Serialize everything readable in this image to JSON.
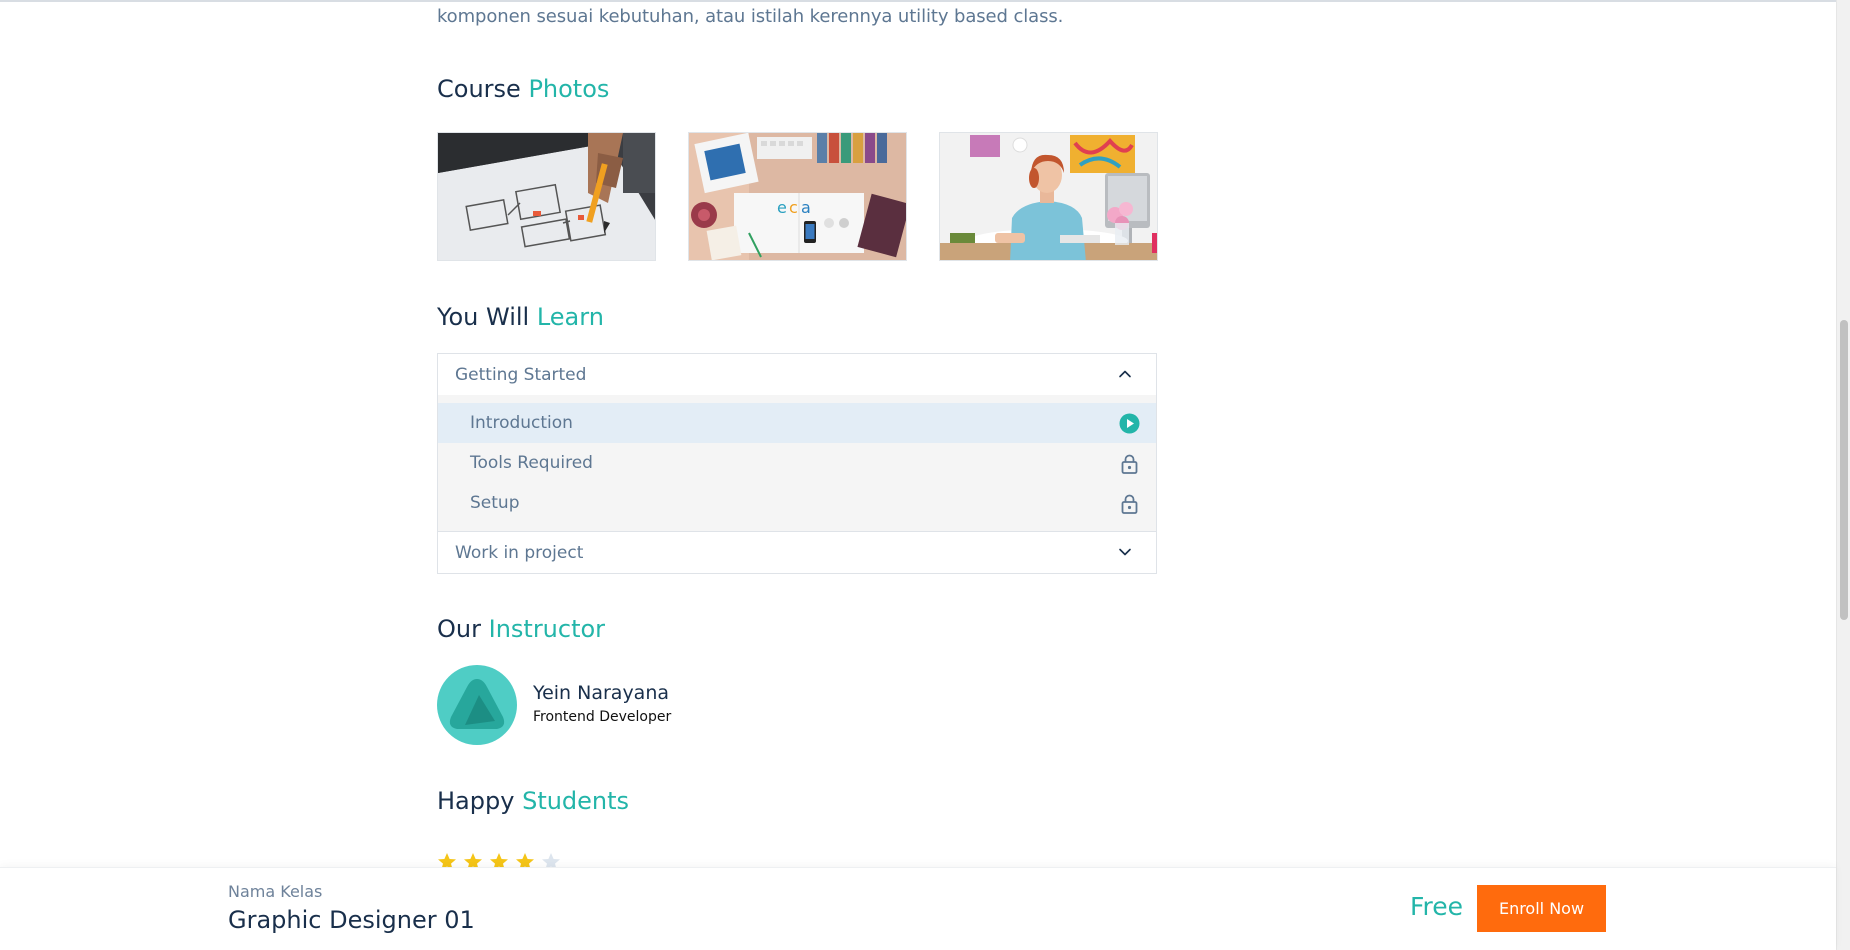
{
  "intro": {
    "text": "komponen sesuai kebutuhan, atau istilah kerennya utility based class."
  },
  "sections": {
    "photos": {
      "part1": "Course",
      "part2": "Photos"
    },
    "learn": {
      "part1": "You Will",
      "part2": "Learn"
    },
    "instructor": {
      "part1": "Our",
      "part2": "Instructor"
    },
    "students": {
      "part1": "Happy",
      "part2": "Students"
    }
  },
  "photos": [
    {
      "name": "wireframe-sketch-photo"
    },
    {
      "name": "desk-flatlay-photo"
    },
    {
      "name": "woman-at-desk-photo"
    }
  ],
  "accordion": {
    "groups": [
      {
        "title": "Getting Started",
        "expanded": true,
        "icon": "chevron-up-icon",
        "lessons": [
          {
            "title": "Introduction",
            "icon": "play-icon",
            "active": true
          },
          {
            "title": "Tools Required",
            "icon": "lock-icon",
            "active": false
          },
          {
            "title": "Setup",
            "icon": "lock-icon",
            "active": false
          }
        ]
      },
      {
        "title": "Work in project",
        "expanded": false,
        "icon": "chevron-down-icon"
      }
    ]
  },
  "instructor": {
    "name": "Yein Narayana",
    "role": "Frontend Developer"
  },
  "rating": {
    "stars": 4,
    "max": 5
  },
  "bottom_bar": {
    "label": "Nama Kelas",
    "title": "Graphic Designer 01",
    "price": "Free",
    "enroll_label": "Enroll Now"
  },
  "colors": {
    "accent": "#23b5a9",
    "heading": "#192f4b",
    "muted": "#5e7792",
    "enroll": "#ff6b0d",
    "star": "#f5c518",
    "star_empty": "#dde5ee"
  }
}
